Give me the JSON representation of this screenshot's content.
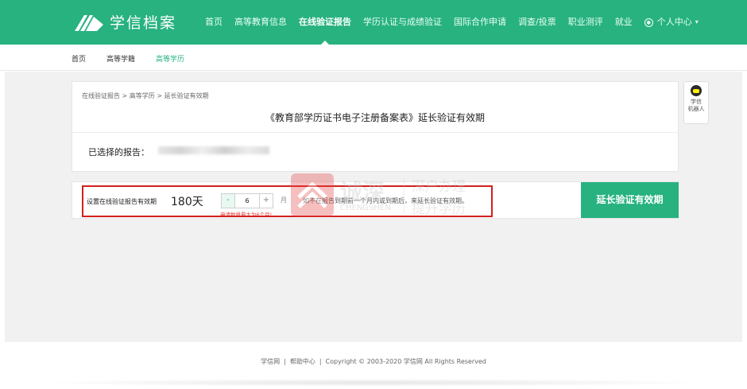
{
  "header": {
    "logo_text": "学信档案",
    "nav": [
      {
        "label": "首页",
        "active": false
      },
      {
        "label": "高等教育信息",
        "active": false
      },
      {
        "label": "在线验证报告",
        "active": true
      },
      {
        "label": "学历认证与成绩验证",
        "active": false
      },
      {
        "label": "国际合作申请",
        "active": false
      },
      {
        "label": "调查/投票",
        "active": false
      },
      {
        "label": "职业测评",
        "active": false
      },
      {
        "label": "就业",
        "active": false
      }
    ],
    "user_menu": "个人中心"
  },
  "subnav": [
    "首页",
    "高等学籍",
    "高等学历"
  ],
  "panel": {
    "breadcrumb": "在线验证报告 > 高等学历 > 延长验证有效期",
    "title": "《教育部学历证书电子注册备案表》延长验证有效期",
    "report_label": "已选择的报告："
  },
  "setting": {
    "label": "设置在线验证报告有效期",
    "days": "180天",
    "minus": "-",
    "value": "6",
    "plus": "+",
    "unit": "月",
    "limit_note": "申请数量最大为6个月!",
    "hint": "如不在报告到期前一个月内或到期后，来延长验证有效期。",
    "button": "延长验证有效期"
  },
  "watermark": {
    "brand_cn": "诚深",
    "brand_en": "CHENGSHEN",
    "line1": "深户办理",
    "line2": "提升学历"
  },
  "robot": {
    "label1": "学信",
    "label2": "机器人"
  },
  "footer": {
    "link1": "学信网",
    "link2": "帮助中心",
    "copyright": "Copyright © 2003-2020 学信网 All Rights Reserved"
  },
  "colors": {
    "brand": "#27b280",
    "highlight": "#d3201e",
    "limit": "#e53935"
  }
}
